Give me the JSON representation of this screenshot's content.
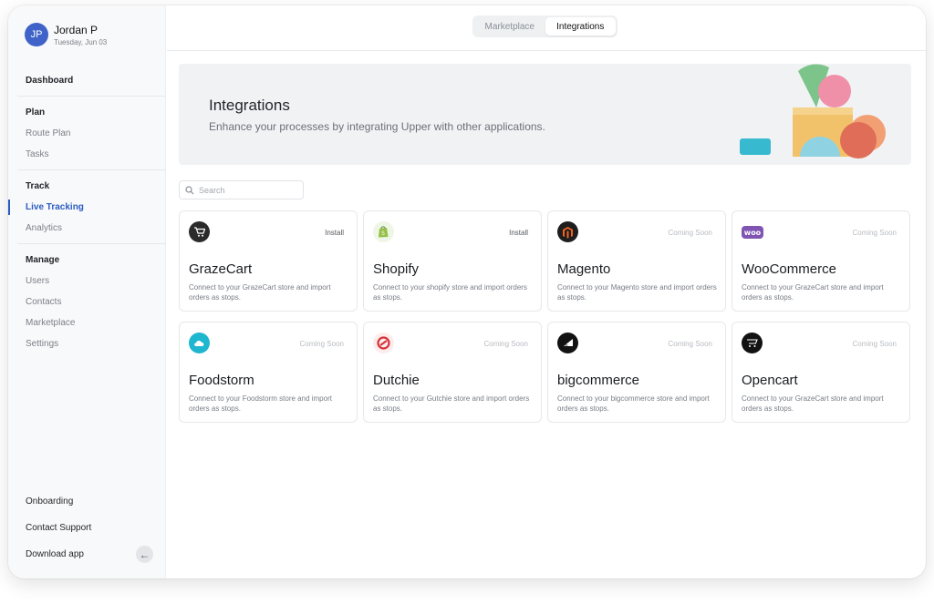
{
  "user": {
    "initials": "JP",
    "name": "Jordan P",
    "date": "Tuesday, Jun 03"
  },
  "sidebar": {
    "dashboard": "Dashboard",
    "plan": {
      "heading": "Plan",
      "items": [
        "Route Plan",
        "Tasks"
      ]
    },
    "track": {
      "heading": "Track",
      "items": [
        "Live Tracking",
        "Analytics"
      ],
      "active": "Live Tracking"
    },
    "manage": {
      "heading": "Manage",
      "items": [
        "Users",
        "Contacts",
        "Marketplace",
        "Settings"
      ]
    },
    "bottom": {
      "onboarding": "Onboarding",
      "support": "Contact Support",
      "download": "Download app"
    }
  },
  "topbar": {
    "tabs": [
      "Marketplace",
      "Integrations"
    ],
    "active_tab": "Integrations"
  },
  "banner": {
    "title": "Integrations",
    "subtitle": "Enhance your processes by integrating Upper with other applications."
  },
  "search": {
    "placeholder": "Search",
    "value": ""
  },
  "integrations": [
    {
      "name": "GrazeCart",
      "status": "Install",
      "description": "Connect to your GrazeCart store and import orders as stops.",
      "icon": "grazecart-icon"
    },
    {
      "name": "Shopify",
      "status": "Install",
      "description": "Connect to your shopify store and import orders as stops.",
      "icon": "shopify-icon"
    },
    {
      "name": "Magento",
      "status": "Coming Soon",
      "description": "Connect to your Magento store and import orders as stops.",
      "icon": "magento-icon"
    },
    {
      "name": "WooCommerce",
      "status": "Coming Soon",
      "description": "Connect to your GrazeCart store and import orders as stops.",
      "icon": "woocommerce-icon",
      "logo_text": "woo"
    },
    {
      "name": "Foodstorm",
      "status": "Coming Soon",
      "description": "Connect to your Foodstorm store and import orders as stops.",
      "icon": "foodstorm-icon"
    },
    {
      "name": "Dutchie",
      "status": "Coming Soon",
      "description": "Connect to your Gutchie store and import orders as stops.",
      "icon": "dutchie-icon"
    },
    {
      "name": "bigcommerce",
      "status": "Coming Soon",
      "description": "Connect to your bigcommerce store and import orders as stops.",
      "icon": "bigcommerce-icon"
    },
    {
      "name": "Opencart",
      "status": "Coming Soon",
      "description": "Connect to your GrazeCart store and import orders as stops.",
      "icon": "opencart-icon"
    }
  ],
  "colors": {
    "accent": "#2b5bc2",
    "avatar": "#3f63c9",
    "woo": "#7f54b3",
    "foodstorm": "#1fb6cf",
    "dutchie": "#d4343a"
  }
}
